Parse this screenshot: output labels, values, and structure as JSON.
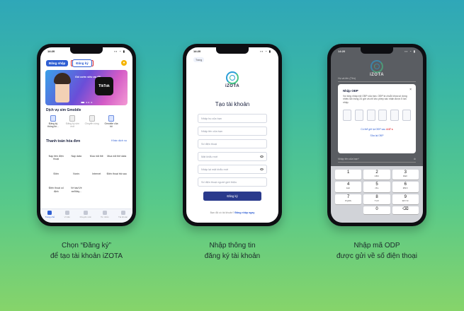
{
  "phone1": {
    "status_time": "14:20",
    "status_icons": "▪▪ ◔ ▮",
    "login_label": "Đăng nhập",
    "register_label": "Đăng ký",
    "bell_icon": "bell-icon",
    "banner_text": "Gói cước siêu ưu đãi",
    "banner_logo": "TikTok",
    "services_title": "Dịch vụ sim Gmobile",
    "services": [
      "Đăng ký thông tin...",
      "Đăng ký sim mới",
      "Chuyển vùng",
      "Gmobile của tôi"
    ],
    "bills_title": "Thanh toán hóa đơn",
    "more_link": "Khác dịch vụ",
    "bills": [
      "Nạp tiền điện thoại",
      "Nạp data",
      "Mua mã thẻ",
      "Mua mã thẻ data",
      "Điện",
      "Nước",
      "Internet",
      "Điện thoại trả sau",
      "Điện thoại cố định",
      "Vé tàu/Vé xe/Máy..."
    ],
    "tabs": [
      "Trang chủ",
      "Ví tiền",
      "Khuyến mãi",
      "Tin nhắn",
      "Tài khoản"
    ]
  },
  "phone2": {
    "status_time": "14:20",
    "status_icons": "▪▪ ◔ ▮",
    "back_label": "Trang",
    "logo_text": "iZOTA",
    "title": "Tạo tài khoản",
    "fields": [
      "Nhập họ của bạn",
      "Nhập tên của bạn",
      "Số điện thoại",
      "Mật khẩu mới",
      "Nhập lại mật khẩu mới",
      "Số điện thoại người giới thiệu"
    ],
    "submit_label": "Đăng ký",
    "already_text": "Bạn đã có tài khoản?",
    "login_link": "Đăng nhập ngay"
  },
  "phone3": {
    "status_time": "14:20",
    "status_icons": "▪▪ ◔ ▮",
    "logo_text": "iZOTA",
    "modal_title": "Nhập OĐP",
    "modal_message": "Vui lòng nhập mã OĐP của bạn. OĐP là chuỗi khóa số dùng nhiều lần trong 24 giờ và chỉ cho phép xác nhận được 5 lần nhập.",
    "resend_prefix": "Có thể gửi lại OĐP sau",
    "resend_timer": "4:37 s",
    "edit_phone": "Sửa lại OĐP",
    "bg_fields": [
      "Họ và tên (Tên)",
      "Nhập tên của bạn*",
      "••••••••"
    ],
    "keys": [
      {
        "n": "1",
        "s": ""
      },
      {
        "n": "2",
        "s": "ABC"
      },
      {
        "n": "3",
        "s": "DEF"
      },
      {
        "n": "4",
        "s": "GHI"
      },
      {
        "n": "5",
        "s": "JKL"
      },
      {
        "n": "6",
        "s": "MNO"
      },
      {
        "n": "7",
        "s": "PQRS"
      },
      {
        "n": "8",
        "s": "TUV"
      },
      {
        "n": "9",
        "s": "WXYZ"
      },
      {
        "n": "",
        "s": ""
      },
      {
        "n": "0",
        "s": ""
      },
      {
        "n": "⌫",
        "s": ""
      }
    ]
  },
  "captions": {
    "c1_line1": "Chọn “Đăng ký”",
    "c1_line2": "để tạo tài khoản iZOTA",
    "c2_line1": "Nhập thông tin",
    "c2_line2": "đăng ký tài khoản",
    "c3_line1": "Nhập mã ODP",
    "c3_line2": "được gửi về số điện thoại"
  },
  "colors": {
    "primary_blue": "#2f5fd3",
    "highlight_red": "#e0262c",
    "button_navy": "#2a3a8c",
    "bg_gradient_top": "#2fa7b8",
    "bg_gradient_bottom": "#86d46a"
  }
}
